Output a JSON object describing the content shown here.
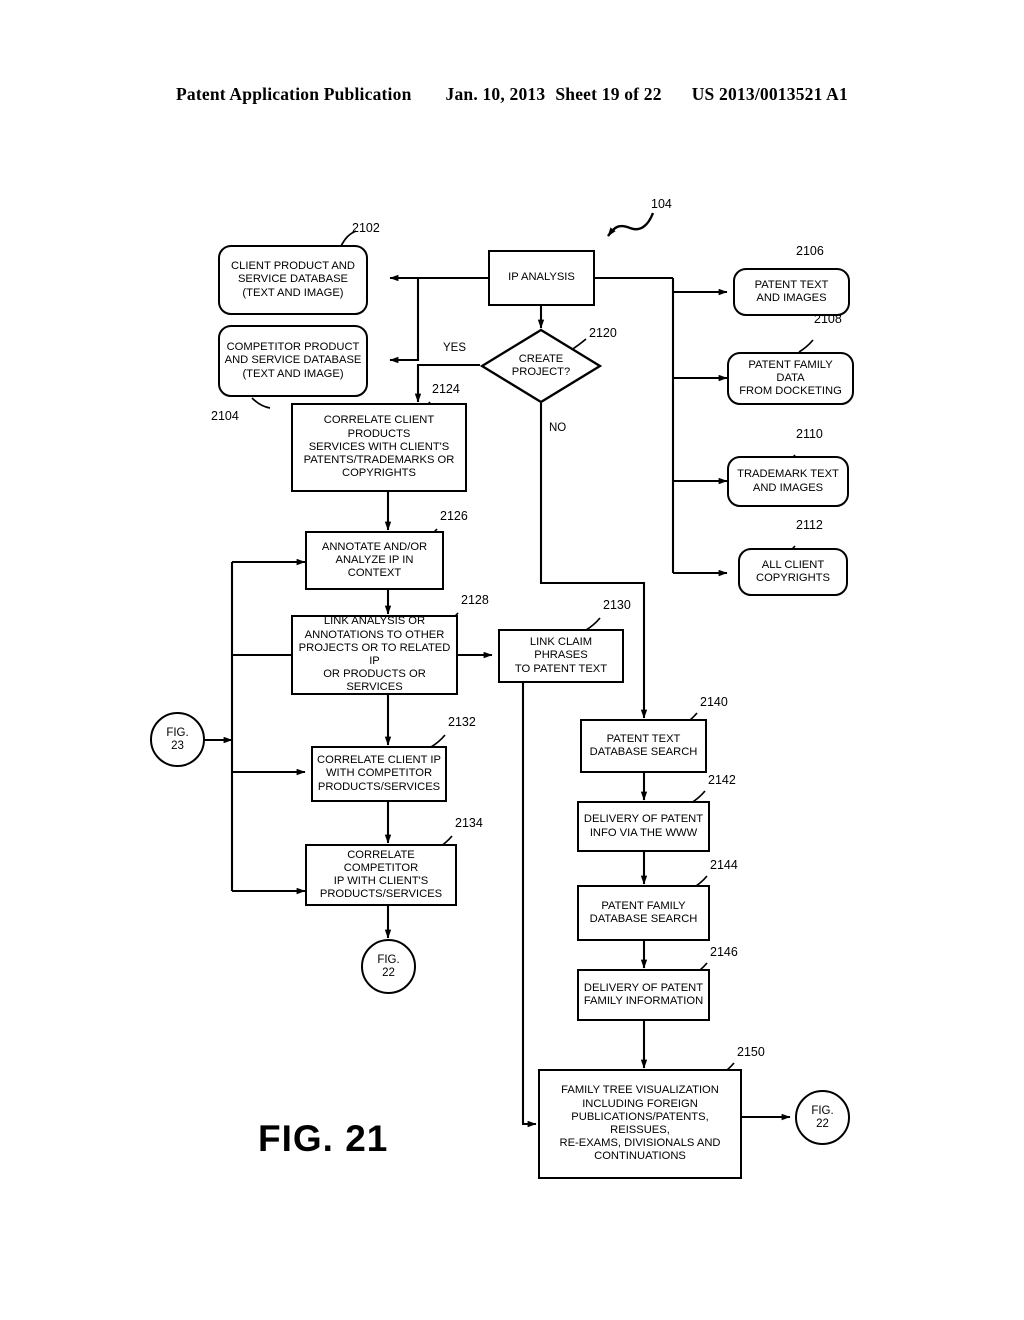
{
  "header": {
    "publication": "Patent Application Publication",
    "date": "Jan. 10, 2013",
    "sheet": "Sheet 19 of 22",
    "patent_number": "US 2013/0013521 A1"
  },
  "figure": {
    "caption": "FIG. 21",
    "system_ref": "104"
  },
  "nodes": [
    {
      "id": "2102",
      "ref": "2102",
      "shape": "rounded",
      "label": "CLIENT PRODUCT AND\nSERVICE DATABASE\n(TEXT AND IMAGE)"
    },
    {
      "id": "2104",
      "ref": "2104",
      "shape": "rounded",
      "label": "COMPETITOR PRODUCT\nAND SERVICE DATABASE\n(TEXT AND IMAGE)"
    },
    {
      "id": "ipan",
      "ref": "",
      "shape": "process",
      "label": "IP ANALYSIS"
    },
    {
      "id": "2120",
      "ref": "2120",
      "shape": "diamond",
      "label": "CREATE\nPROJECT?"
    },
    {
      "id": "2106",
      "ref": "2106",
      "shape": "rounded",
      "label": "PATENT TEXT\nAND IMAGES"
    },
    {
      "id": "2108",
      "ref": "2108",
      "shape": "rounded",
      "label": "PATENT FAMILY DATA\nFROM DOCKETING"
    },
    {
      "id": "2110",
      "ref": "2110",
      "shape": "rounded",
      "label": "TRADEMARK TEXT\nAND IMAGES"
    },
    {
      "id": "2112",
      "ref": "2112",
      "shape": "rounded",
      "label": "ALL CLIENT\nCOPYRIGHTS"
    },
    {
      "id": "2124",
      "ref": "2124",
      "shape": "process",
      "label": "CORRELATE CLIENT PRODUCTS\nSERVICES WITH CLIENT'S\nPATENTS/TRADEMARKS OR\nCOPYRIGHTS"
    },
    {
      "id": "2126",
      "ref": "2126",
      "shape": "process",
      "label": "ANNOTATE AND/OR\nANALYZE IP IN\nCONTEXT"
    },
    {
      "id": "2128",
      "ref": "2128",
      "shape": "process",
      "label": "LINK ANALYSIS OR\nANNOTATIONS TO OTHER\nPROJECTS OR TO RELATED IP\nOR PRODUCTS OR SERVICES"
    },
    {
      "id": "2130",
      "ref": "2130",
      "shape": "process",
      "label": "LINK CLAIM PHRASES\nTO PATENT TEXT"
    },
    {
      "id": "2132",
      "ref": "2132",
      "shape": "process",
      "label": "CORRELATE CLIENT IP\nWITH COMPETITOR\nPRODUCTS/SERVICES"
    },
    {
      "id": "2134",
      "ref": "2134",
      "shape": "process",
      "label": "CORRELATE COMPETITOR\nIP WITH CLIENT'S\nPRODUCTS/SERVICES"
    },
    {
      "id": "2140",
      "ref": "2140",
      "shape": "process",
      "label": "PATENT TEXT\nDATABASE SEARCH"
    },
    {
      "id": "2142",
      "ref": "2142",
      "shape": "process",
      "label": "DELIVERY OF PATENT\nINFO VIA THE WWW"
    },
    {
      "id": "2144",
      "ref": "2144",
      "shape": "process",
      "label": "PATENT FAMILY\nDATABASE SEARCH"
    },
    {
      "id": "2146",
      "ref": "2146",
      "shape": "process",
      "label": "DELIVERY OF PATENT\nFAMILY INFORMATION"
    },
    {
      "id": "2150",
      "ref": "2150",
      "shape": "process",
      "label": "FAMILY TREE VISUALIZATION\nINCLUDING FOREIGN\nPUBLICATIONS/PATENTS, REISSUES,\nRE-EXAMS, DIVISIONALS AND\nCONTINUATIONS"
    }
  ],
  "connectors": {
    "yes_label": "YES",
    "no_label": "NO"
  },
  "offpage": [
    {
      "id": "fig23",
      "line1": "FIG.",
      "line2": "23"
    },
    {
      "id": "fig22a",
      "line1": "FIG.",
      "line2": "22"
    },
    {
      "id": "fig22b",
      "line1": "FIG.",
      "line2": "22"
    }
  ],
  "colors": {
    "ink": "#000000",
    "paper": "#ffffff"
  }
}
